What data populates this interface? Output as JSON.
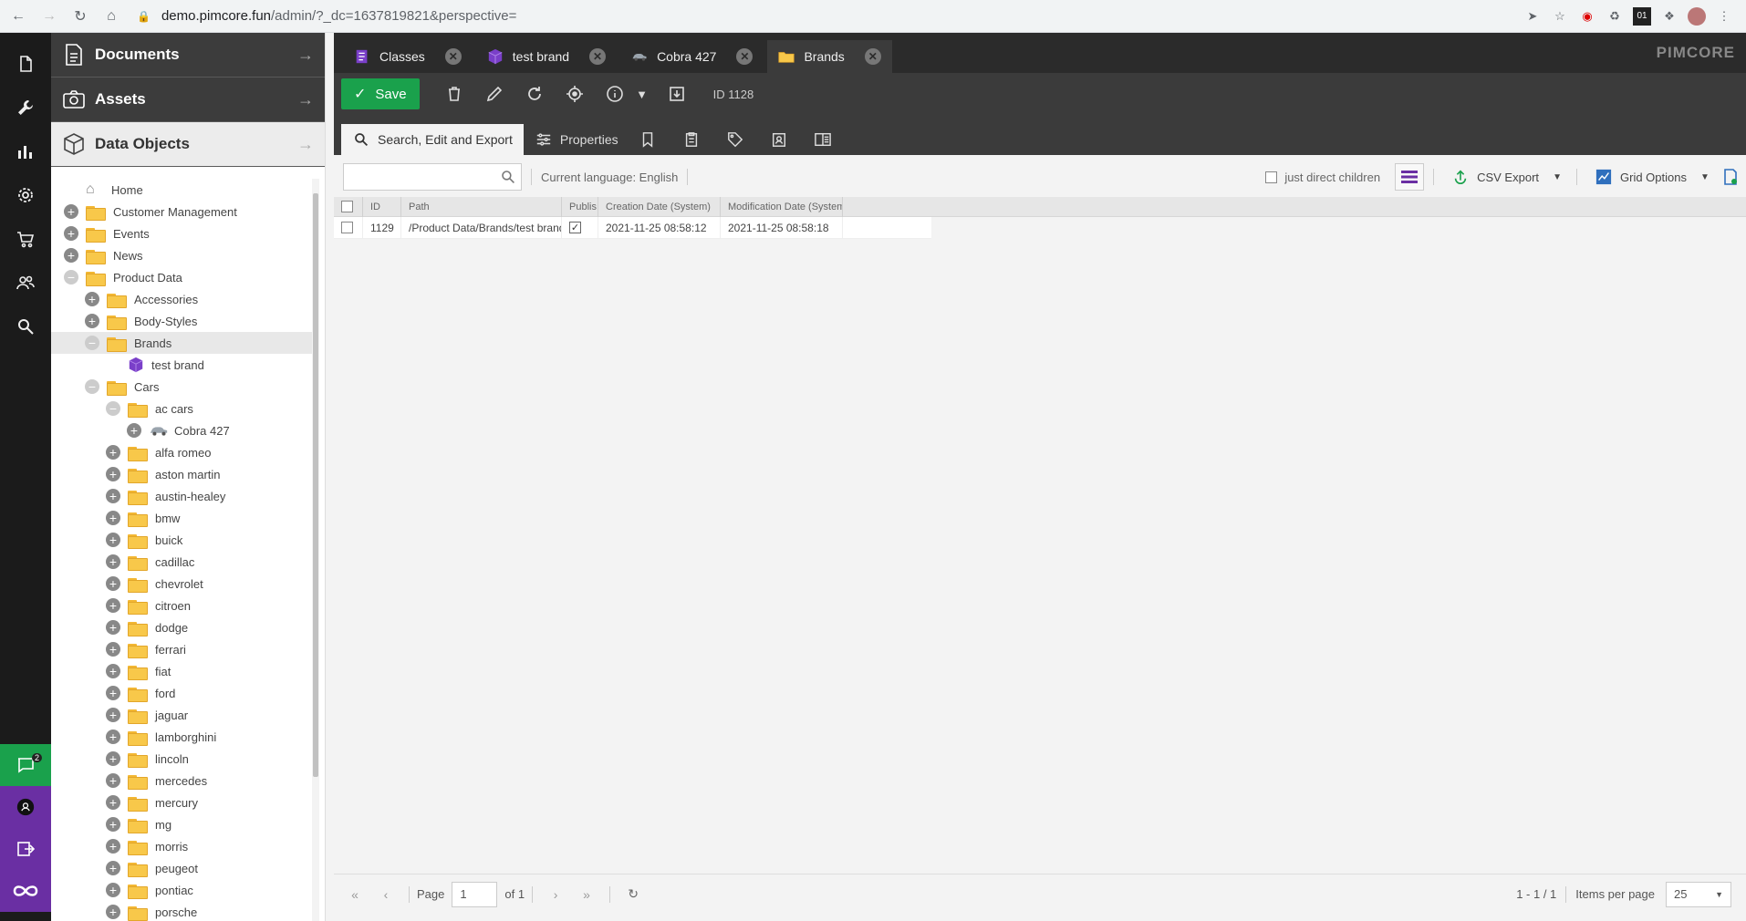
{
  "browser": {
    "url_host": "demo.pimcore.fun",
    "url_path": "/admin/?_dc=1637819821&perspective="
  },
  "sidebar": {
    "notification_count": "2"
  },
  "tree_panel": {
    "sections": {
      "documents": "Documents",
      "assets": "Assets",
      "data_objects": "Data Objects"
    },
    "items": [
      {
        "label": "Home",
        "level": 0,
        "toggle": "none",
        "icon": "home-icon"
      },
      {
        "label": "Customer Management",
        "level": 0,
        "toggle": "plus",
        "icon": "folder-icon"
      },
      {
        "label": "Events",
        "level": 0,
        "toggle": "plus",
        "icon": "folder-icon"
      },
      {
        "label": "News",
        "level": 0,
        "toggle": "plus",
        "icon": "folder-icon"
      },
      {
        "label": "Product Data",
        "level": 0,
        "toggle": "minus",
        "icon": "folder-icon"
      },
      {
        "label": "Accessories",
        "level": 1,
        "toggle": "plus",
        "icon": "folder-icon"
      },
      {
        "label": "Body-Styles",
        "level": 1,
        "toggle": "plus",
        "icon": "folder-icon"
      },
      {
        "label": "Brands",
        "level": 1,
        "toggle": "minus",
        "icon": "folder-icon",
        "selected": true
      },
      {
        "label": "test brand",
        "level": 2,
        "toggle": "none",
        "icon": "cube-icon"
      },
      {
        "label": "Cars",
        "level": 1,
        "toggle": "minus",
        "icon": "folder-icon"
      },
      {
        "label": "ac cars",
        "level": 2,
        "toggle": "minus",
        "icon": "folder-icon"
      },
      {
        "label": "Cobra 427",
        "level": 3,
        "toggle": "plus",
        "icon": "car-icon"
      },
      {
        "label": "alfa romeo",
        "level": 2,
        "toggle": "plus",
        "icon": "folder-icon"
      },
      {
        "label": "aston martin",
        "level": 2,
        "toggle": "plus",
        "icon": "folder-icon"
      },
      {
        "label": "austin-healey",
        "level": 2,
        "toggle": "plus",
        "icon": "folder-icon"
      },
      {
        "label": "bmw",
        "level": 2,
        "toggle": "plus",
        "icon": "folder-icon"
      },
      {
        "label": "buick",
        "level": 2,
        "toggle": "plus",
        "icon": "folder-icon"
      },
      {
        "label": "cadillac",
        "level": 2,
        "toggle": "plus",
        "icon": "folder-icon"
      },
      {
        "label": "chevrolet",
        "level": 2,
        "toggle": "plus",
        "icon": "folder-icon"
      },
      {
        "label": "citroen",
        "level": 2,
        "toggle": "plus",
        "icon": "folder-icon"
      },
      {
        "label": "dodge",
        "level": 2,
        "toggle": "plus",
        "icon": "folder-icon"
      },
      {
        "label": "ferrari",
        "level": 2,
        "toggle": "plus",
        "icon": "folder-icon"
      },
      {
        "label": "fiat",
        "level": 2,
        "toggle": "plus",
        "icon": "folder-icon"
      },
      {
        "label": "ford",
        "level": 2,
        "toggle": "plus",
        "icon": "folder-icon"
      },
      {
        "label": "jaguar",
        "level": 2,
        "toggle": "plus",
        "icon": "folder-icon"
      },
      {
        "label": "lamborghini",
        "level": 2,
        "toggle": "plus",
        "icon": "folder-icon"
      },
      {
        "label": "lincoln",
        "level": 2,
        "toggle": "plus",
        "icon": "folder-icon"
      },
      {
        "label": "mercedes",
        "level": 2,
        "toggle": "plus",
        "icon": "folder-icon"
      },
      {
        "label": "mercury",
        "level": 2,
        "toggle": "plus",
        "icon": "folder-icon"
      },
      {
        "label": "mg",
        "level": 2,
        "toggle": "plus",
        "icon": "folder-icon"
      },
      {
        "label": "morris",
        "level": 2,
        "toggle": "plus",
        "icon": "folder-icon"
      },
      {
        "label": "peugeot",
        "level": 2,
        "toggle": "plus",
        "icon": "folder-icon"
      },
      {
        "label": "pontiac",
        "level": 2,
        "toggle": "plus",
        "icon": "folder-icon"
      },
      {
        "label": "porsche",
        "level": 2,
        "toggle": "plus",
        "icon": "folder-icon"
      }
    ]
  },
  "editor_tabs": [
    {
      "label": "Classes",
      "icon": "classes-icon",
      "active": false
    },
    {
      "label": "test brand",
      "icon": "cube-icon",
      "active": false
    },
    {
      "label": "Cobra 427",
      "icon": "car-icon",
      "active": false
    },
    {
      "label": "Brands",
      "icon": "folder-icon",
      "active": true
    }
  ],
  "brand": "PIMCORE",
  "toolbar": {
    "save_label": "Save",
    "id_label": "ID 1128"
  },
  "subtabs": {
    "search_label": "Search, Edit and Export",
    "properties_label": "Properties"
  },
  "grid_toolbar": {
    "search_placeholder": "",
    "language_label": "Current language: English",
    "direct_children_label": "just direct children",
    "csv_export_label": "CSV Export",
    "grid_options_label": "Grid Options"
  },
  "grid": {
    "columns": [
      "ID",
      "Path",
      "Publis",
      "Creation Date (System)",
      "Modification Date (System)"
    ],
    "rows": [
      {
        "id": "1129",
        "path": "/Product Data/Brands/test brand",
        "published": true,
        "created": "2021-11-25 08:58:12",
        "modified": "2021-11-25 08:58:18"
      }
    ]
  },
  "pager": {
    "page_label": "Page",
    "page_value": "1",
    "of_label": "of 1",
    "summary": "1 - 1 / 1",
    "items_per_page_label": "Items per page",
    "items_per_page_value": "25"
  },
  "colors": {
    "accent_green": "#1aa14c",
    "accent_purple": "#6a2fa3",
    "dark_bg": "#2b2b2b"
  }
}
